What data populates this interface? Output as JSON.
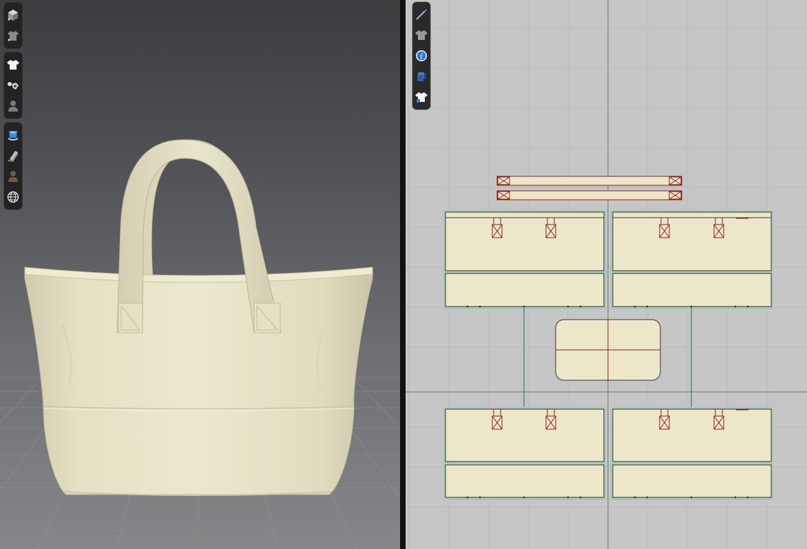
{
  "window": {
    "title": ""
  },
  "viewport_3d": {
    "background_top": "#3d3d40",
    "background_bottom": "#87878a",
    "garment_color": "#e6e3c7",
    "toolbar_groups": [
      {
        "name": "display-group",
        "tools": [
          {
            "id": "show-avatar-mesh",
            "icon": "cube-icon"
          },
          {
            "id": "show-garment-settings",
            "icon": "garment-settings-icon"
          }
        ]
      },
      {
        "name": "garment-group",
        "tools": [
          {
            "id": "show-garment",
            "icon": "tshirt-icon"
          },
          {
            "id": "show-pins",
            "icon": "pin-tools-icon"
          },
          {
            "id": "show-avatar",
            "icon": "avatar-icon"
          }
        ]
      },
      {
        "name": "render-group",
        "tools": [
          {
            "id": "texture-surface",
            "icon": "texture-surface-icon"
          },
          {
            "id": "thickness",
            "icon": "thickness-icon"
          },
          {
            "id": "avatar-texture",
            "icon": "avatar-texture-icon"
          },
          {
            "id": "environment",
            "icon": "globe-icon"
          }
        ]
      }
    ]
  },
  "viewport_2d": {
    "background": "#c6c6c6",
    "fabric_color": "#ede7c9",
    "seam_color": "#5aa88a",
    "internal_line_color": "#8b1a1a",
    "toolbar": [
      {
        "id": "show-baseline",
        "icon": "needle-icon"
      },
      {
        "id": "show-garment-2d",
        "icon": "shirt-gray-icon"
      },
      {
        "id": "show-info",
        "icon": "info-icon"
      },
      {
        "id": "show-fabric-texture",
        "icon": "fabric-texture-icon"
      },
      {
        "id": "show-grainline",
        "icon": "shirt-grain-icon"
      }
    ],
    "pieces": [
      {
        "name": "handle-strap-1"
      },
      {
        "name": "handle-strap-2"
      },
      {
        "name": "front-upper-left"
      },
      {
        "name": "front-upper-right"
      },
      {
        "name": "front-lower-left"
      },
      {
        "name": "front-lower-right"
      },
      {
        "name": "bottom-panel"
      },
      {
        "name": "back-upper-left"
      },
      {
        "name": "back-upper-right"
      },
      {
        "name": "back-lower-left"
      },
      {
        "name": "back-lower-right"
      }
    ]
  }
}
